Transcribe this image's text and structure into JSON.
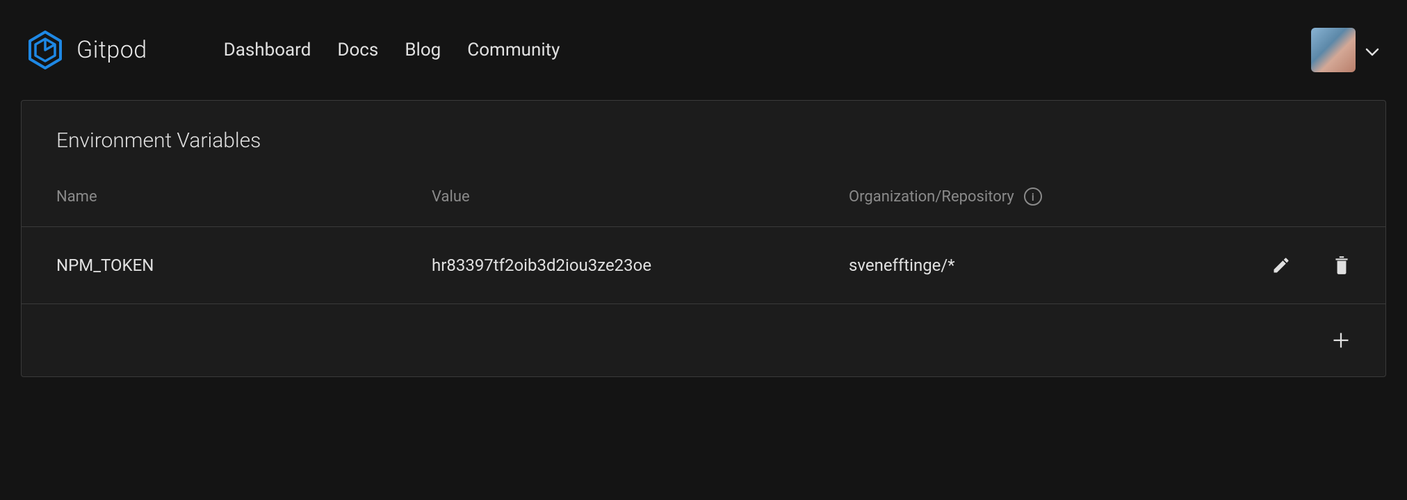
{
  "brand": "Gitpod",
  "nav": {
    "dashboard": "Dashboard",
    "docs": "Docs",
    "blog": "Blog",
    "community": "Community"
  },
  "panel": {
    "title": "Environment Variables",
    "columns": {
      "name": "Name",
      "value": "Value",
      "org": "Organization/Repository"
    },
    "rows": [
      {
        "name": "NPM_TOKEN",
        "value": "hr83397tf2oib3d2iou3ze23oe",
        "org": "svenefftinge/*"
      }
    ]
  },
  "colors": {
    "accent": "#1e88e5"
  }
}
